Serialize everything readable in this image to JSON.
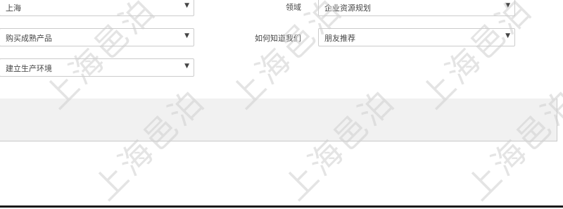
{
  "form": {
    "city": {
      "value": "上海"
    },
    "domain": {
      "label": "领域",
      "value": "企业资源规划"
    },
    "purpose": {
      "value": "购买成熟产品"
    },
    "source": {
      "label": "如何知道我们",
      "value": "朋友推荐"
    },
    "environment": {
      "value": "建立生产环境"
    }
  },
  "watermark": {
    "text": "上海邑泊"
  },
  "icons": {
    "dropdown": "caret-down-icon",
    "caret_glyph": "▼"
  }
}
